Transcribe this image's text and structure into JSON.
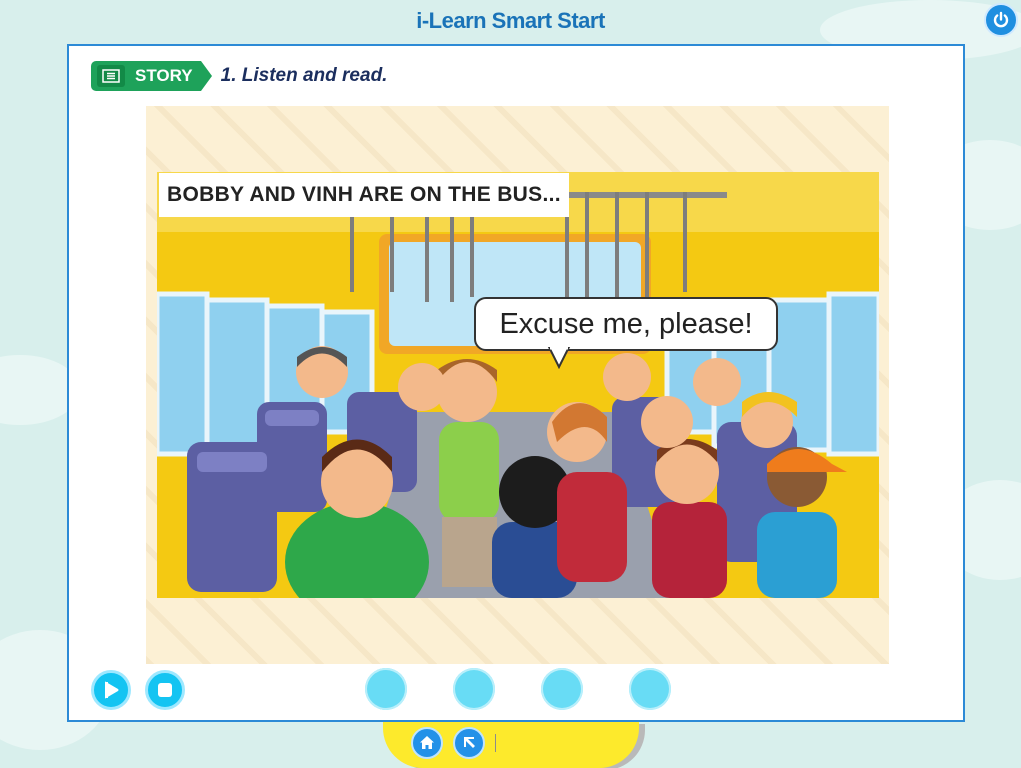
{
  "app": {
    "title": "i-Learn Smart Start"
  },
  "lesson": {
    "tag_label": "STORY",
    "instruction": "1. Listen and read."
  },
  "story": {
    "caption": "BOBBY AND VINH ARE ON THE BUS...",
    "speech_bubble": "Excuse me, please!"
  },
  "controls": {
    "play_icon": "play-icon",
    "stop_icon": "stop-icon",
    "page_dots": 4
  },
  "bottom_nav": {
    "home_icon": "home-icon",
    "back_icon": "back-arrow-icon"
  },
  "colors": {
    "title_blue": "#1a73b8",
    "story_green": "#1ea25a",
    "control_cyan": "#14c4f2",
    "bus_yellow": "#f2c40f",
    "nav_yellow": "#fdea2c"
  }
}
